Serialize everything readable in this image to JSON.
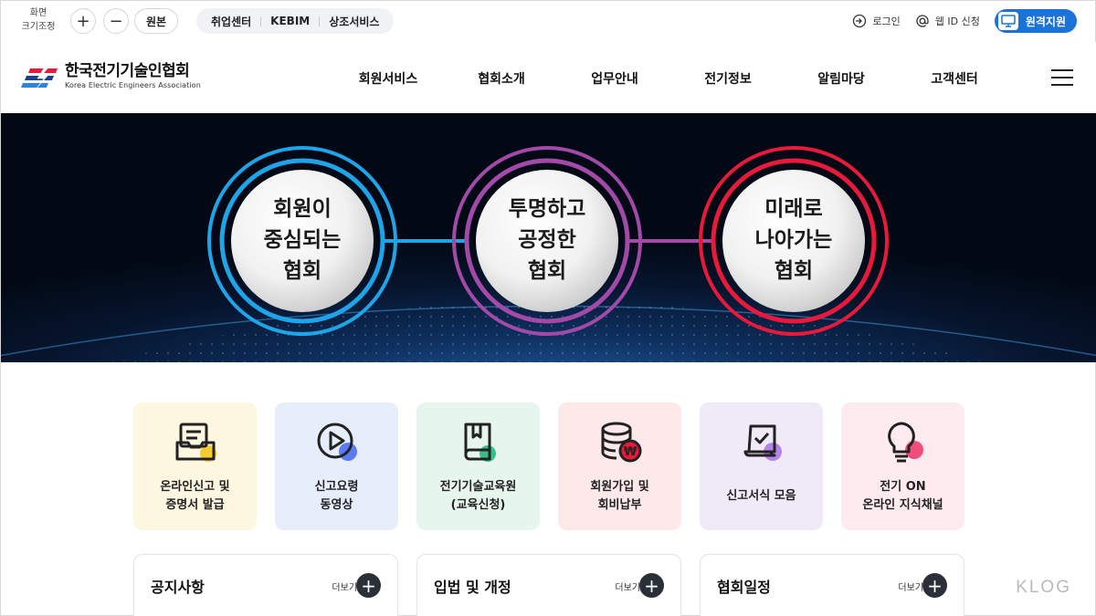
{
  "util": {
    "zoom_label_line1": "화면",
    "zoom_label_line2": "크기조정",
    "zoom_in": "+",
    "zoom_out": "−",
    "original": "원본",
    "services": [
      "취업센터",
      "KEBIM",
      "상조서비스"
    ],
    "login": "로그인",
    "web_id": "웹 ID 신청",
    "remote": "원격지원"
  },
  "header": {
    "logo_name": "한국전기기술인협회",
    "logo_sub": "Korea Electric Engineers Association",
    "nav": [
      "회원서비스",
      "협회소개",
      "업무안내",
      "전기정보",
      "알림마당",
      "고객센터"
    ]
  },
  "hero": {
    "circles": [
      {
        "line1": "회원이",
        "line2": "중심되는",
        "line3": "협회",
        "ring_color": "#1ea4e8"
      },
      {
        "line1": "투명하고",
        "line2": "공정한",
        "line3": "협회",
        "ring_color": "#a349a8"
      },
      {
        "line1": "미래로",
        "line2": "나아가는",
        "line3": "협회",
        "ring_color": "#e8193a"
      }
    ]
  },
  "quick": [
    {
      "line1": "온라인신고 및",
      "line2": "증명서 발급",
      "icon": "document-tray-icon",
      "bg": "#fdf6e0",
      "accent": "#f5cb2d"
    },
    {
      "line1": "신고요령",
      "line2": "동영상",
      "icon": "play-video-icon",
      "bg": "#e6eefc",
      "accent": "#5a7bf2"
    },
    {
      "line1": "전기기술교육원",
      "line2": "(교육신청)",
      "icon": "book-icon",
      "bg": "#e6f6ee",
      "accent": "#35c08a"
    },
    {
      "line1": "회원가입 및",
      "line2": "회비납부",
      "icon": "coin-stack-icon",
      "bg": "#fde8ea",
      "accent": "#e8193a"
    },
    {
      "line1": "신고서식 모음",
      "line2": "",
      "icon": "scroll-form-icon",
      "bg": "#efe9f8",
      "accent": "#b583e6"
    },
    {
      "line1": "전기 ON",
      "line2": "온라인 지식채널",
      "icon": "lightbulb-icon",
      "bg": "#fdebf0",
      "accent": "#f04d7a"
    }
  ],
  "boards": [
    {
      "title": "공지사항",
      "more": "더보기"
    },
    {
      "title": "입법 및 개정",
      "more": "더보기"
    },
    {
      "title": "협회일정",
      "more": "더보기"
    }
  ],
  "watermark": "KLOG"
}
